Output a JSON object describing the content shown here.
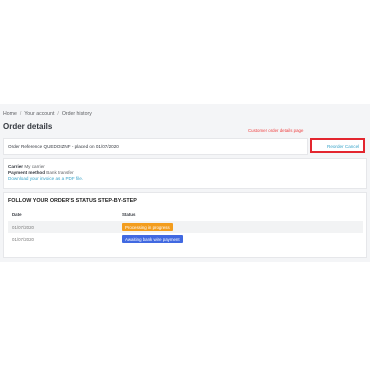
{
  "breadcrumb": [
    "Home",
    "Your account",
    "Order history"
  ],
  "page_title": "Order details",
  "annotation": "Customer order details page",
  "order_reference": "Order Reference QUEDOIZNF - placed on 01/07/2020",
  "reorder_label": "Reorder Cancel",
  "carrier": {
    "carrier_label": "Carrier",
    "carrier_value": "My carrier",
    "payment_label": "Payment method",
    "payment_value": "Bank transfer",
    "invoice_link": "Download your invoice as a PDF file."
  },
  "status_section": {
    "title": "FOLLOW YOUR ORDER'S STATUS STEP-BY-STEP",
    "headers": {
      "date": "Date",
      "status": "Status"
    },
    "rows": [
      {
        "date": "01/07/2020",
        "status": "Processing in progress",
        "color": "#f39d1e"
      },
      {
        "date": "01/07/2020",
        "status": "Awaiting bank wire payment",
        "color": "#4169e1"
      }
    ]
  },
  "colors": {
    "link": "#37a3c9",
    "annotation": "#ef4040",
    "highlight_border": "#e3262f"
  }
}
